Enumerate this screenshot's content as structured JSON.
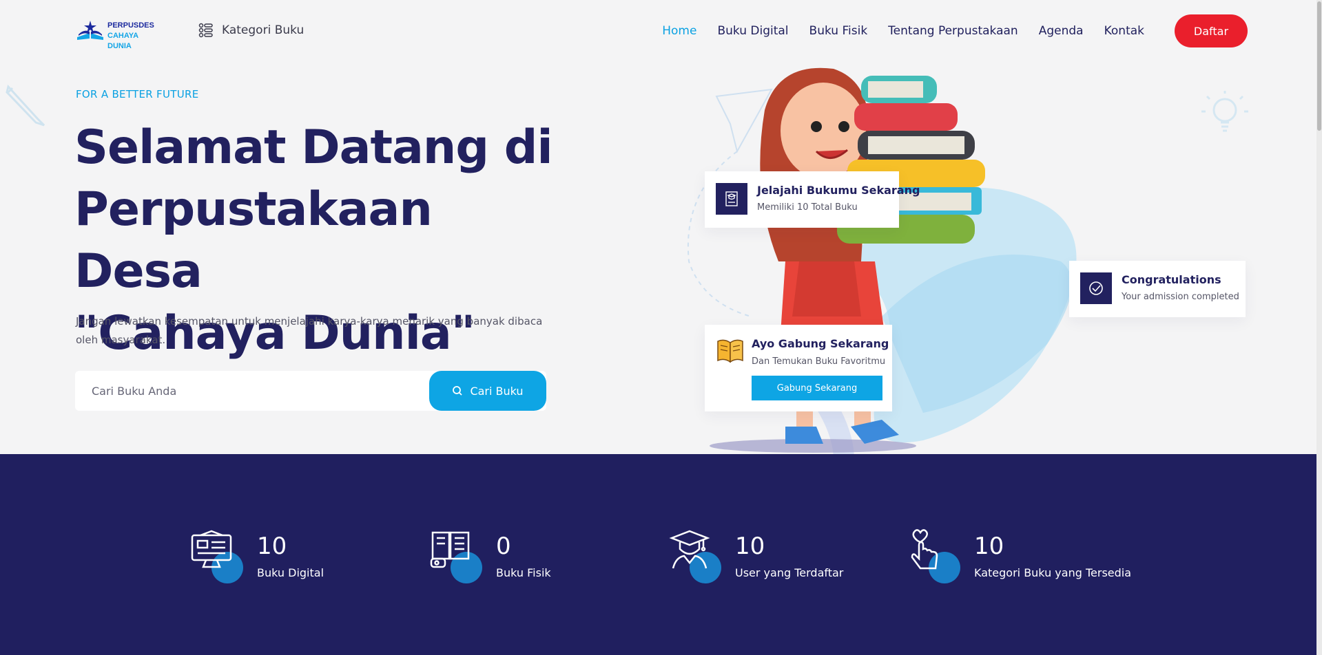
{
  "header": {
    "logo": {
      "line1": "PERPUSDES",
      "line2": "CAHAYA DUNIA"
    },
    "category_label": "Kategori Buku",
    "nav": [
      {
        "label": "Home",
        "active": true
      },
      {
        "label": "Buku Digital",
        "active": false
      },
      {
        "label": "Buku Fisik",
        "active": false
      },
      {
        "label": "Tentang Perpustakaan",
        "active": false
      },
      {
        "label": "Agenda",
        "active": false
      },
      {
        "label": "Kontak",
        "active": false
      }
    ],
    "register_label": "Daftar"
  },
  "hero": {
    "tagline": "FOR A BETTER FUTURE",
    "title_line1": "Selamat Datang di",
    "title_line2": "Perpustakaan Desa",
    "title_line3": "\"Cahaya Dunia\"",
    "subtitle": "Jangan lewatkan kesempatan untuk menjelajahi karya-karya menarik yang banyak dibaca oleh masyarakat.",
    "search_placeholder": "Cari Buku Anda",
    "search_button": "Cari Buku"
  },
  "cards": {
    "explore": {
      "title": "Jelajahi Bukumu Sekarang",
      "subtitle": "Memiliki 10 Total Buku"
    },
    "congrats": {
      "title": "Congratulations",
      "subtitle": "Your admission completed"
    },
    "join": {
      "title": "Ayo Gabung Sekarang",
      "subtitle": "Dan Temukan Buku Favoritmu",
      "button": "Gabung Sekarang"
    }
  },
  "stats": [
    {
      "value": "10",
      "label": "Buku Digital",
      "icon": "digital-book-icon"
    },
    {
      "value": "0",
      "label": "Buku Fisik",
      "icon": "physical-book-icon"
    },
    {
      "value": "10",
      "label": "User yang Terdaftar",
      "icon": "graduate-user-icon"
    },
    {
      "value": "10",
      "label": "Kategori Buku yang Tersedia",
      "icon": "heart-hand-icon"
    }
  ],
  "colors": {
    "navy": "#22215f",
    "accent_blue": "#0ea5e4",
    "red": "#ea1f2c",
    "band": "#201f5f"
  }
}
